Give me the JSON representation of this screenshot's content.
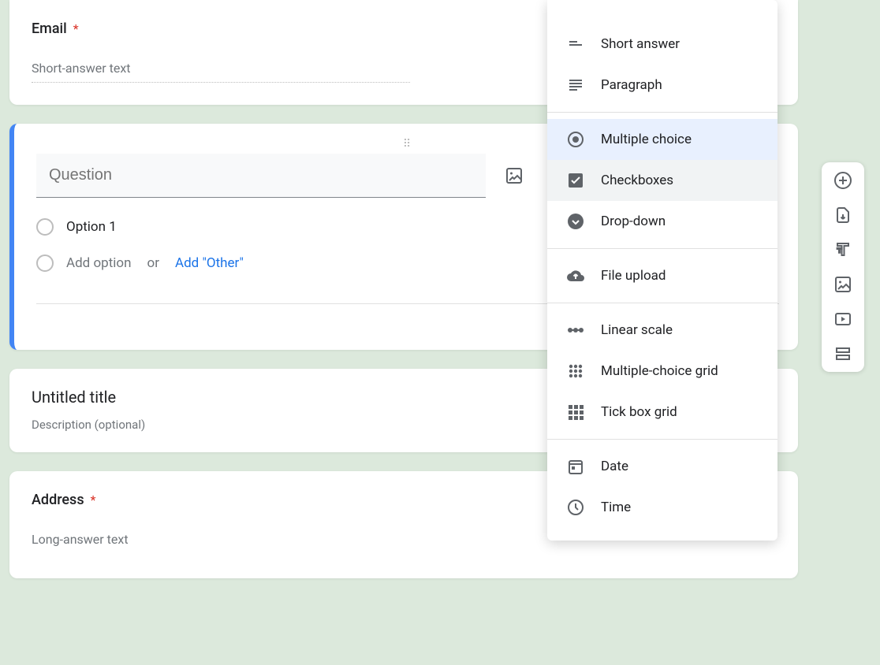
{
  "email": {
    "label": "Email",
    "required_mark": "*",
    "placeholder": "Short-answer text"
  },
  "question": {
    "placeholder": "Question",
    "option1": "Option 1",
    "add_option": "Add option",
    "or": "or",
    "add_other": "Add \"Other\""
  },
  "type_menu": {
    "short_answer": "Short answer",
    "paragraph": "Paragraph",
    "multiple_choice": "Multiple choice",
    "checkboxes": "Checkboxes",
    "dropdown": "Drop-down",
    "file_upload": "File upload",
    "linear_scale": "Linear scale",
    "mc_grid": "Multiple-choice grid",
    "tickbox_grid": "Tick box grid",
    "date": "Date",
    "time": "Time"
  },
  "section": {
    "title": "Untitled title",
    "desc": "Description (optional)"
  },
  "address": {
    "label": "Address",
    "required_mark": "*",
    "placeholder": "Long-answer text"
  }
}
